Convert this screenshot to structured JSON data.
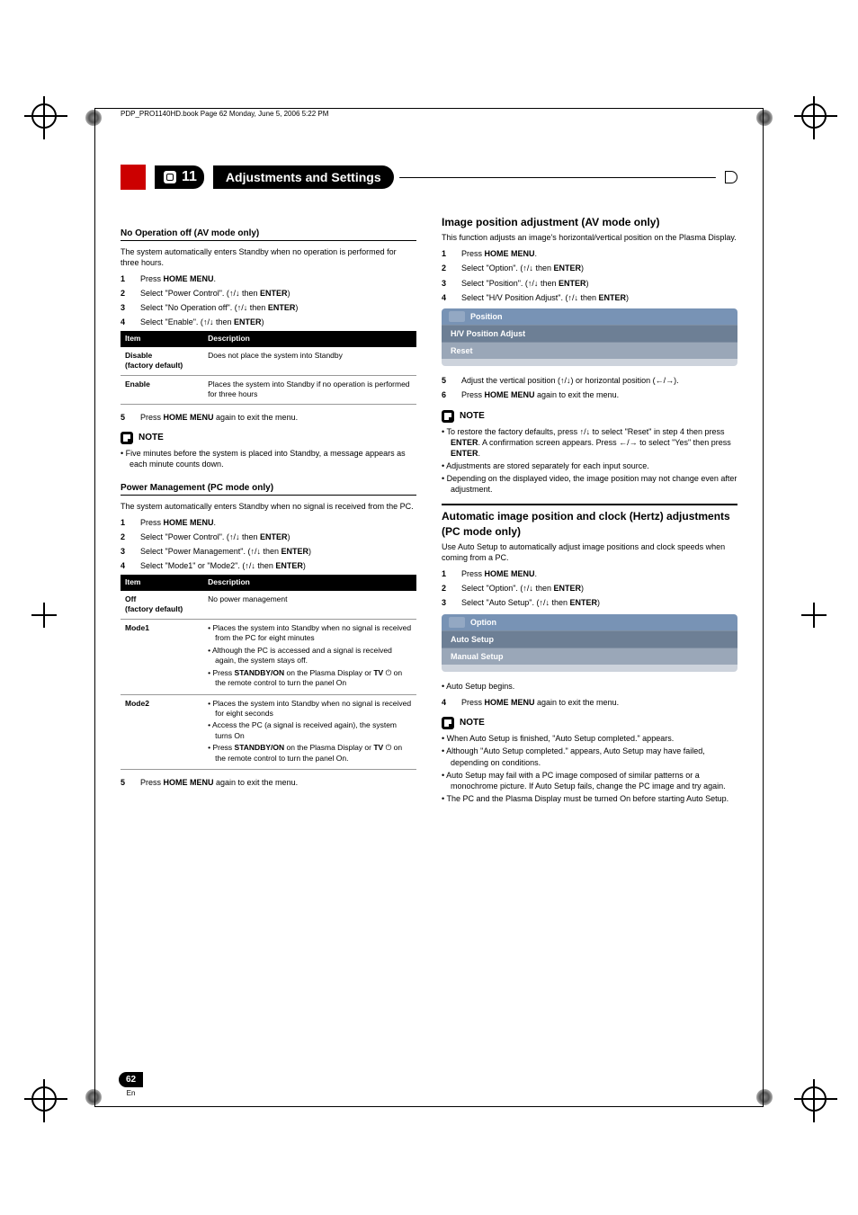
{
  "書頁": {
    "書籤": "PDP_PRO1140HD.book  Page 62  Monday, June 5, 2006  5:22 PM",
    "頁碼": "62",
    "語言": "En"
  },
  "章節": {
    "號碼": "11",
    "標題": "Adjustments and Settings"
  },
  "圖示": {
    "上箭頭": "↑",
    "下箭頭": "↓",
    "左箭頭": "←",
    "右箭頭": "→",
    "电源": "⏻"
  },
  "左欄": {
    "第1節": {
      "標題": "No Operation off (AV mode only)",
      "說明": "The system automatically enters Standby when no operation is performed for three hours.",
      "步驟": [
        {
          "n": "1",
          "前綴": "Press ",
          "粗體": "HOME MENU",
          "後綴": "."
        },
        {
          "n": "2",
          "前綴": "Select \"Power Control\". (",
          "粗體": "ENTER",
          "中間": " then ",
          "後綴": ")"
        },
        {
          "n": "3",
          "前綴": "Select \"No Operation off\". (",
          "粗體": "ENTER",
          "中間": " then ",
          "後綴": ")"
        },
        {
          "n": "4",
          "前綴": "Select \"Enable\". (",
          "粗體": "ENTER",
          "中間": " then ",
          "後綴": ")"
        }
      ],
      "表格": {
        "頭": [
          "Item",
          "Description"
        ],
        "行": [
          {
            "k": "Disable\n(factory default)",
            "v": "Does not place the system into Standby"
          },
          {
            "k": "Enable",
            "v": "Places the system into Standby if no operation is performed for three hours"
          }
        ]
      },
      "步驟5": {
        "n": "5",
        "前綴": "Press ",
        "粗體": "HOME MENU",
        "後綴": " again to exit the menu."
      },
      "備註標題": "NOTE",
      "備註": [
        "Five minutes before the system is placed into Standby, a message appears as each minute counts down."
      ]
    },
    "第2節": {
      "標題": "Power Management (PC mode only)",
      "說明": "The system automatically enters Standby when no signal is received from the PC.",
      "步驟": [
        {
          "n": "1",
          "前綴": "Press ",
          "粗體": "HOME MENU",
          "後綴": "."
        },
        {
          "n": "2",
          "前綴": "Select \"Power Control\". (",
          "粗體": "ENTER",
          "中間": " then ",
          "後綴": ")"
        },
        {
          "n": "3",
          "前綴": "Select \"Power Management\". (",
          "粗體": "ENTER",
          "中間": " then ",
          "後綴": ")"
        },
        {
          "n": "4",
          "前綴": "Select \"Mode1\" or \"Mode2\". (",
          "粗體": "ENTER",
          "中間": " then ",
          "後綴": ")"
        }
      ],
      "表格": {
        "頭": [
          "Item",
          "Description"
        ],
        "行": [
          {
            "k": "Off\n(factory default)",
            "v": "No power management"
          },
          {
            "k": "Mode1",
            "清單": [
              "Places the system into Standby when no signal is received from the PC for eight minutes",
              "Although the PC is accessed and a signal is received again, the system stays off.",
              {
                "前綴": "Press ",
                "粗1": "STANDBY/ON",
                "中": " on the Plasma Display or ",
                "粗2": "TV ",
                "電源": true,
                "後": " on the remote control to turn the panel On"
              }
            ]
          },
          {
            "k": "Mode2",
            "清單": [
              "Places the system into Standby when no signal is received for eight seconds",
              "Access the PC (a signal is received again), the system turns On",
              {
                "前綴": "Press ",
                "粗1": "STANDBY/ON",
                "中": " on the Plasma Display or ",
                "粗2": "TV ",
                "電源": true,
                "後": " on the remote control to turn the panel On."
              }
            ]
          }
        ]
      },
      "步驟5": {
        "n": "5",
        "前綴": "Press ",
        "粗體": "HOME MENU",
        "後綴": " again to exit the menu."
      }
    }
  },
  "右欄": {
    "第1節": {
      "標題": "Image position adjustment (AV mode only)",
      "說明": "This function adjusts an image's horizontal/vertical position on the Plasma Display.",
      "步驟": [
        {
          "n": "1",
          "前綴": "Press ",
          "粗體": "HOME MENU",
          "後綴": "."
        },
        {
          "n": "2",
          "前綴": "Select \"Option\". (",
          "粗體": "ENTER",
          "中間": " then ",
          "後綴": ")"
        },
        {
          "n": "3",
          "前綴": "Select \"Position\". (",
          "粗體": "ENTER",
          "中間": " then ",
          "後綴": ")"
        },
        {
          "n": "4",
          "前綴": "Select \"H/V Position Adjust\". (",
          "粗體": "ENTER",
          "中間": " then ",
          "後綴": ")"
        }
      ],
      "選單": {
        "標題": "Position",
        "項": [
          "H/V Position Adjust",
          "Reset"
        ]
      },
      "步驟5": {
        "n": "5",
        "文": "Adjust the vertical position (↑/↓) or horizontal position (←/→)."
      },
      "步驟6": {
        "n": "6",
        "前綴": "Press ",
        "粗體": "HOME MENU",
        "後綴": " again to exit the menu."
      },
      "備註標題": "NOTE",
      "備註": [
        {
          "前": "To restore the factory defaults, press ↑/↓ to select \"Reset\" in step 4 then press ",
          "粗1": "ENTER",
          "中": ". A confirmation screen appears. Press ←/→ to select \"Yes\" then press ",
          "粗2": "ENTER",
          "後": "."
        },
        "Adjustments are stored separately for each input source.",
        "Depending on the displayed video, the image position may not change even after adjustment."
      ]
    },
    "第2節": {
      "標題": "Automatic image position and clock (Hertz) adjustments (PC mode only)",
      "說明": "Use Auto Setup to automatically adjust image positions and clock speeds when coming from a PC.",
      "步驟": [
        {
          "n": "1",
          "前綴": "Press ",
          "粗體": "HOME MENU",
          "後綴": "."
        },
        {
          "n": "2",
          "前綴": "Select \"Option\". (",
          "粗體": "ENTER",
          "中間": " then ",
          "後綴": ")"
        },
        {
          "n": "3",
          "前綴": "Select \"Auto Setup\". (",
          "粗體": "ENTER",
          "中間": " then ",
          "後綴": ")"
        }
      ],
      "選單": {
        "標題": "Option",
        "項": [
          "Auto Setup",
          "Manual Setup"
        ]
      },
      "子彈": "Auto Setup begins.",
      "步驟4": {
        "n": "4",
        "前綴": "Press ",
        "粗體": "HOME MENU",
        "後綴": " again to exit the menu."
      },
      "備註標題": "NOTE",
      "備註": [
        "When Auto Setup is finished, \"Auto Setup completed.\" appears.",
        "Although \"Auto Setup completed.\" appears, Auto Setup may have failed, depending on conditions.",
        "Auto Setup may fail with a PC image composed of similar patterns or a monochrome picture. If Auto Setup fails, change the PC image and try again.",
        "The PC and the Plasma Display must be turned On before starting Auto Setup."
      ]
    }
  }
}
